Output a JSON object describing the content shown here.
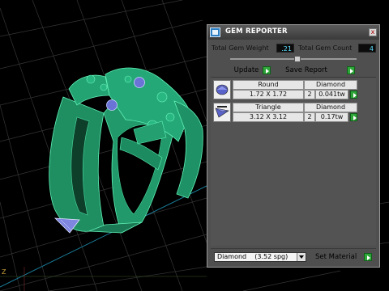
{
  "panel": {
    "title": "GEM REPORTER",
    "close_glyph": "x",
    "total_weight_label": "Total Gem Weight",
    "total_weight_value": ".21",
    "total_count_label": "Total Gem Count",
    "total_count_value": "4",
    "slider_position": 0.53,
    "update_label": "Update",
    "save_report_label": "Save Report",
    "gems": [
      {
        "icon": "round-gem-icon",
        "shape": "Round",
        "size": "1.72 X 1.72",
        "material": "Diamond",
        "count": "2",
        "weight": "0.041tw"
      },
      {
        "icon": "triangle-gem-icon",
        "shape": "Triangle",
        "size": "3.12 X 3.12",
        "material": "Diamond",
        "count": "2",
        "weight": "0.17tw"
      }
    ],
    "material_select_value": "Diamond    (3.52 spg)",
    "set_material_label": "Set Material"
  },
  "colors": {
    "ring_green": "#1f9a6a",
    "grid_line": "#3a3a3a",
    "axis_blue": "#1a7f9c",
    "gem_blue": "#6a73d6",
    "accent_green": "#2fa63a"
  },
  "viewport": {
    "axis_label": "Z"
  }
}
